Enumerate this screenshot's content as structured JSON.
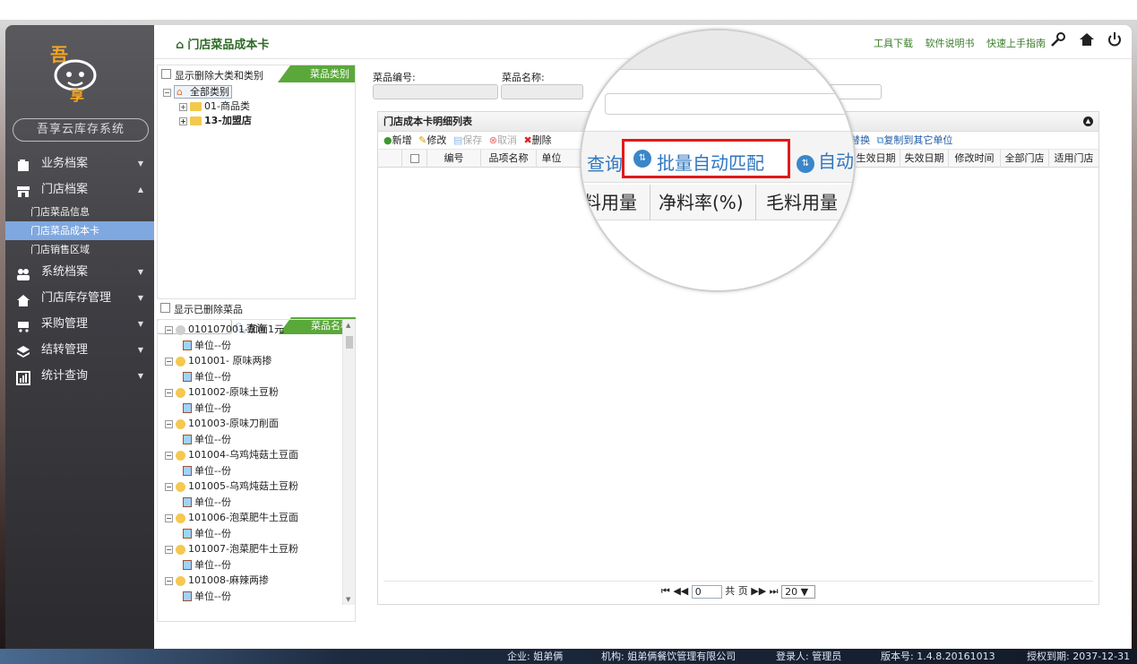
{
  "sidebar": {
    "system_name": "吾享云库存系统",
    "menu": [
      {
        "label": "业务档案",
        "icon": "folder-icon",
        "expanded": false
      },
      {
        "label": "门店档案",
        "icon": "store-icon",
        "expanded": true,
        "children": [
          "门店菜品信息",
          "门店菜品成本卡",
          "门店销售区域"
        ],
        "active_child": "门店菜品成本卡"
      },
      {
        "label": "系统档案",
        "icon": "users-icon",
        "expanded": false
      },
      {
        "label": "门店库存管理",
        "icon": "home-icon",
        "expanded": false
      },
      {
        "label": "采购管理",
        "icon": "cart-icon",
        "expanded": false
      },
      {
        "label": "结转管理",
        "icon": "layers-icon",
        "expanded": false
      },
      {
        "label": "统计查询",
        "icon": "chart-icon",
        "expanded": false
      }
    ]
  },
  "topbar": {
    "breadcrumb": "门店菜品成本卡",
    "links": [
      "工具下载",
      "软件说明书",
      "快速上手指南"
    ]
  },
  "category_panel": {
    "show_deleted_label": "显示删除大类和类别",
    "tab_label": "菜品类别",
    "tree": {
      "root": "全部类别",
      "children": [
        "01-商品类",
        "13-加盟店"
      ]
    }
  },
  "dish_panel": {
    "show_deleted_label": "显示已删除菜品",
    "query_label": "查询",
    "tab_label": "菜品名称",
    "items": [
      {
        "name": "010107001-加面1元",
        "unit": "单位--份"
      },
      {
        "name": "101001- 原味两掺",
        "unit": "单位--份"
      },
      {
        "name": "101002-原味土豆粉",
        "unit": "单位--份"
      },
      {
        "name": "101003-原味刀削面",
        "unit": "单位--份"
      },
      {
        "name": "101004-乌鸡炖菇土豆面",
        "unit": "单位--份"
      },
      {
        "name": "101005-乌鸡炖菇土豆粉",
        "unit": "单位--份"
      },
      {
        "name": "101006-泡菜肥牛土豆面",
        "unit": "单位--份"
      },
      {
        "name": "101007-泡菜肥牛土豆粉",
        "unit": "单位--份"
      },
      {
        "name": "101008-麻辣两掺",
        "unit": "单位--份"
      }
    ]
  },
  "filter_form": {
    "dish_code_label": "菜品编号:",
    "dish_name_label": "菜品名称:"
  },
  "grid": {
    "title": "门店成本卡明细列表",
    "toolbar": {
      "add": "新增",
      "edit": "修改",
      "save": "保存",
      "cancel": "取消",
      "delete": "删除",
      "replace": "批替换",
      "copy": "复制到其它单位"
    },
    "columns": [
      "编号",
      "品项名称",
      "单位",
      "生效日期",
      "失效日期",
      "修改时间",
      "全部门店",
      "适用门店"
    ],
    "pager": {
      "page": "0",
      "total_label": "共 页",
      "page_size": "20"
    }
  },
  "magnifier": {
    "query": "查询",
    "batch_match": "批量自动匹配",
    "auto_prefix": "自动",
    "columns": [
      "料用量",
      "净料率(%)",
      "毛料用量"
    ]
  },
  "statusbar": {
    "company": "企业: 姐弟俩",
    "org": "机构: 姐弟俩餐饮管理有限公司",
    "user": "登录人: 管理员",
    "version": "版本号: 1.4.8.20161013",
    "expiry": "授权到期: 2037-12-31"
  }
}
